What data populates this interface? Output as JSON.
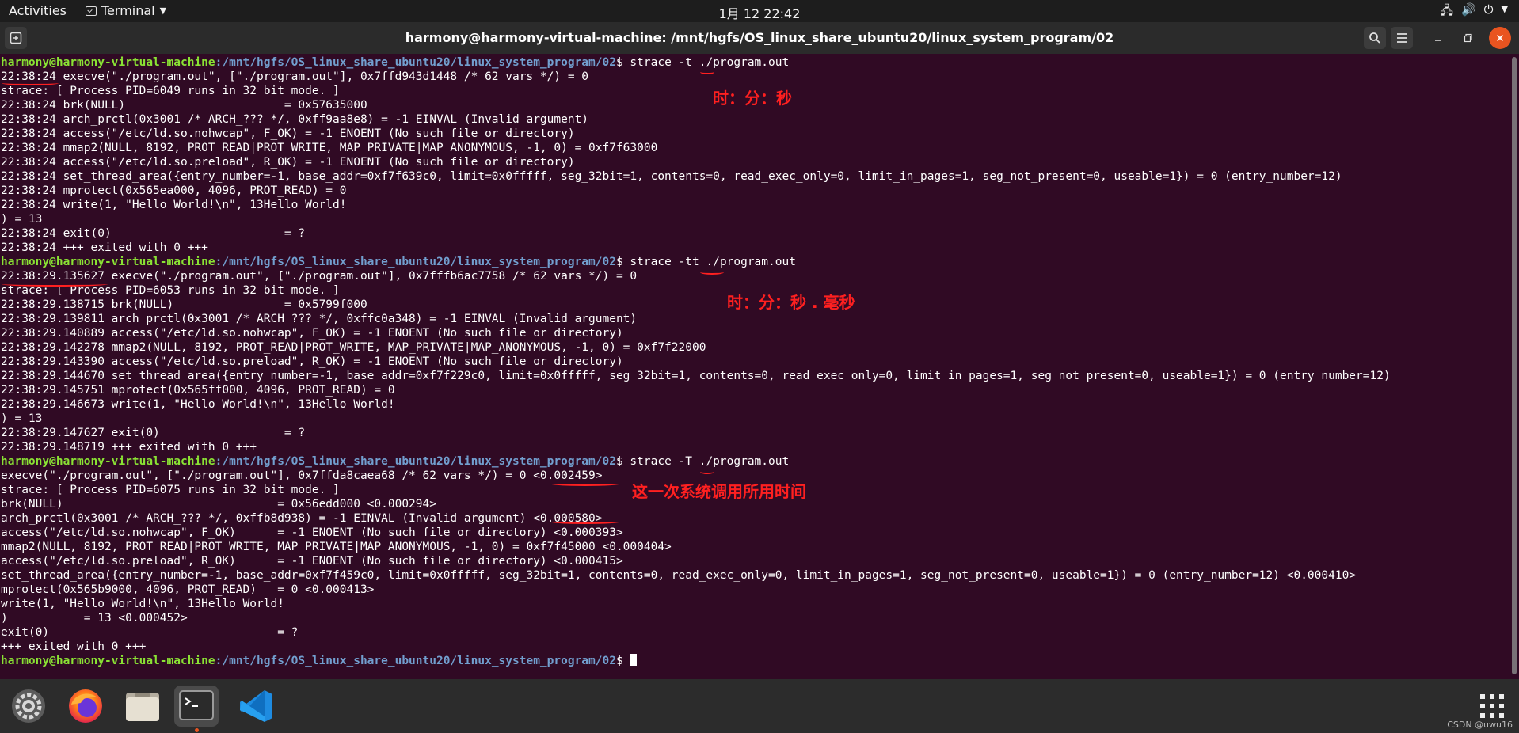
{
  "topbar": {
    "activities": "Activities",
    "app_name": "Terminal",
    "clock": "1月 12  22:42"
  },
  "window": {
    "title": "harmony@harmony-virtual-machine: /mnt/hgfs/OS_linux_share_ubuntu20/linux_system_program/02"
  },
  "prompt": {
    "user_host": "harmony@harmony-virtual-machine",
    "path": ":/mnt/hgfs/OS_linux_share_ubuntu20/linux_system_program/02",
    "symbol": "$"
  },
  "terminal": {
    "block1": {
      "cmd": " strace -t ./program.out",
      "output": "22:38:24 execve(\"./program.out\", [\"./program.out\"], 0x7ffd943d1448 /* 62 vars */) = 0\nstrace: [ Process PID=6049 runs in 32 bit mode. ]\n22:38:24 brk(NULL)                       = 0x57635000\n22:38:24 arch_prctl(0x3001 /* ARCH_??? */, 0xff9aa8e8) = -1 EINVAL (Invalid argument)\n22:38:24 access(\"/etc/ld.so.nohwcap\", F_OK) = -1 ENOENT (No such file or directory)\n22:38:24 mmap2(NULL, 8192, PROT_READ|PROT_WRITE, MAP_PRIVATE|MAP_ANONYMOUS, -1, 0) = 0xf7f63000\n22:38:24 access(\"/etc/ld.so.preload\", R_OK) = -1 ENOENT (No such file or directory)\n22:38:24 set_thread_area({entry_number=-1, base_addr=0xf7f639c0, limit=0x0fffff, seg_32bit=1, contents=0, read_exec_only=0, limit_in_pages=1, seg_not_present=0, useable=1}) = 0 (entry_number=12)\n22:38:24 mprotect(0x565ea000, 4096, PROT_READ) = 0\n22:38:24 write(1, \"Hello World!\\n\", 13Hello World!\n) = 13\n22:38:24 exit(0)                         = ?\n22:38:24 +++ exited with 0 +++"
    },
    "block2": {
      "cmd": " strace -tt ./program.out",
      "output": "22:38:29.135627 execve(\"./program.out\", [\"./program.out\"], 0x7fffb6ac7758 /* 62 vars */) = 0\nstrace: [ Process PID=6053 runs in 32 bit mode. ]\n22:38:29.138715 brk(NULL)                = 0x5799f000\n22:38:29.139811 arch_prctl(0x3001 /* ARCH_??? */, 0xffc0a348) = -1 EINVAL (Invalid argument)\n22:38:29.140889 access(\"/etc/ld.so.nohwcap\", F_OK) = -1 ENOENT (No such file or directory)\n22:38:29.142278 mmap2(NULL, 8192, PROT_READ|PROT_WRITE, MAP_PRIVATE|MAP_ANONYMOUS, -1, 0) = 0xf7f22000\n22:38:29.143390 access(\"/etc/ld.so.preload\", R_OK) = -1 ENOENT (No such file or directory)\n22:38:29.144670 set_thread_area({entry_number=-1, base_addr=0xf7f229c0, limit=0x0fffff, seg_32bit=1, contents=0, read_exec_only=0, limit_in_pages=1, seg_not_present=0, useable=1}) = 0 (entry_number=12)\n22:38:29.145751 mprotect(0x565ff000, 4096, PROT_READ) = 0\n22:38:29.146673 write(1, \"Hello World!\\n\", 13Hello World!\n) = 13\n22:38:29.147627 exit(0)                  = ?\n22:38:29.148719 +++ exited with 0 +++"
    },
    "block3": {
      "cmd": " strace -T ./program.out",
      "output": "execve(\"./program.out\", [\"./program.out\"], 0x7ffda8caea68 /* 62 vars */) = 0 <0.002459>\nstrace: [ Process PID=6075 runs in 32 bit mode. ]\nbrk(NULL)                               = 0x56edd000 <0.000294>\narch_prctl(0x3001 /* ARCH_??? */, 0xffb8d938) = -1 EINVAL (Invalid argument) <0.000580>\naccess(\"/etc/ld.so.nohwcap\", F_OK)      = -1 ENOENT (No such file or directory) <0.000393>\nmmap2(NULL, 8192, PROT_READ|PROT_WRITE, MAP_PRIVATE|MAP_ANONYMOUS, -1, 0) = 0xf7f45000 <0.000404>\naccess(\"/etc/ld.so.preload\", R_OK)      = -1 ENOENT (No such file or directory) <0.000415>\nset_thread_area({entry_number=-1, base_addr=0xf7f459c0, limit=0x0fffff, seg_32bit=1, contents=0, read_exec_only=0, limit_in_pages=1, seg_not_present=0, useable=1}) = 0 (entry_number=12) <0.000410>\nmprotect(0x565b9000, 4096, PROT_READ)   = 0 <0.000413>\nwrite(1, \"Hello World!\\n\", 13Hello World!\n)           = 13 <0.000452>\nexit(0)                                 = ?\n+++ exited with 0 +++"
    }
  },
  "annotations": {
    "a1": "时：分：秒",
    "a2": "时：分：秒 . 毫秒",
    "a3": "这一次系统调用所用时间"
  },
  "colors": {
    "terminal_bg": "#300a24",
    "prompt_user": "#8ae234",
    "prompt_path": "#729fcf",
    "annotation": "#ff2020"
  },
  "dock": {
    "icons": [
      "settings-icon",
      "firefox-icon",
      "files-icon",
      "terminal-icon",
      "vscode-icon",
      "app-grid-icon"
    ]
  },
  "watermark": "CSDN @uwu16"
}
